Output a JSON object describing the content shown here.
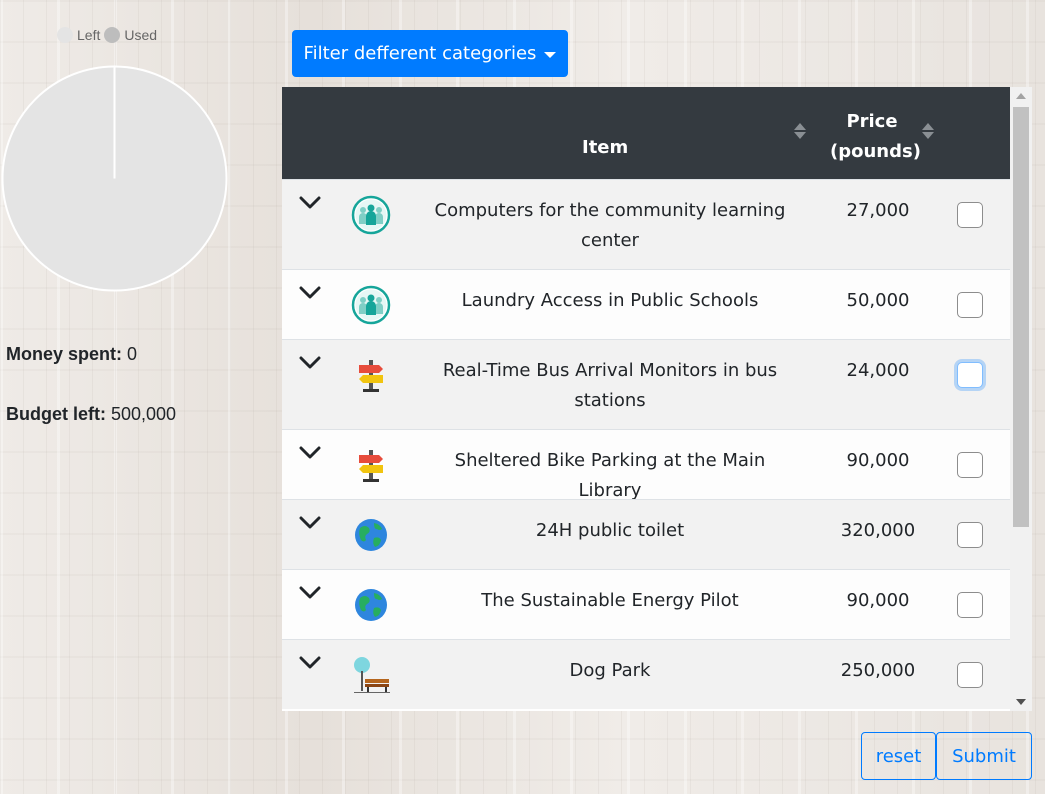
{
  "chart": {
    "legend": [
      {
        "label": "Left",
        "color": "#e4e4e4"
      },
      {
        "label": "Used",
        "color": "#bdbdbd"
      }
    ]
  },
  "chart_data": {
    "type": "pie",
    "categories": [
      "Left",
      "Used"
    ],
    "values": [
      500000,
      0
    ]
  },
  "stats": {
    "spent_label": "Money spent:",
    "spent_value": "0",
    "left_label": "Budget left:",
    "left_value": "500,000"
  },
  "filter": {
    "label": "Filter defferent categories"
  },
  "table": {
    "headers": {
      "item": "Item",
      "price_line1": "Price",
      "price_line2": "(pounds)"
    },
    "rows": [
      {
        "name_lines": [
          "Computers for the community learning",
          "center"
        ],
        "price": "27,000",
        "icon": "community-icon",
        "checked": false,
        "focused": false
      },
      {
        "name_lines": [
          "Laundry Access in Public Schools"
        ],
        "price": "50,000",
        "icon": "community-icon",
        "checked": false,
        "focused": false
      },
      {
        "name_lines": [
          "Real-Time Bus Arrival Monitors in bus",
          "stations"
        ],
        "price": "24,000",
        "icon": "signpost-icon",
        "checked": false,
        "focused": true
      },
      {
        "name_lines": [
          "Sheltered Bike Parking at the Main Library"
        ],
        "price": "90,000",
        "icon": "signpost-icon",
        "checked": false,
        "focused": false
      },
      {
        "name_lines": [
          "24H public toilet"
        ],
        "price": "320,000",
        "icon": "globe-icon",
        "checked": false,
        "focused": false
      },
      {
        "name_lines": [
          "The Sustainable Energy Pilot"
        ],
        "price": "90,000",
        "icon": "globe-icon",
        "checked": false,
        "focused": false
      },
      {
        "name_lines": [
          "Dog Park"
        ],
        "price": "250,000",
        "icon": "park-bench-icon",
        "checked": false,
        "focused": false
      }
    ]
  },
  "actions": {
    "reset_label": "reset",
    "submit_label": "Submit"
  },
  "colors": {
    "primary": "#007bff",
    "header_bg": "#343a40"
  }
}
